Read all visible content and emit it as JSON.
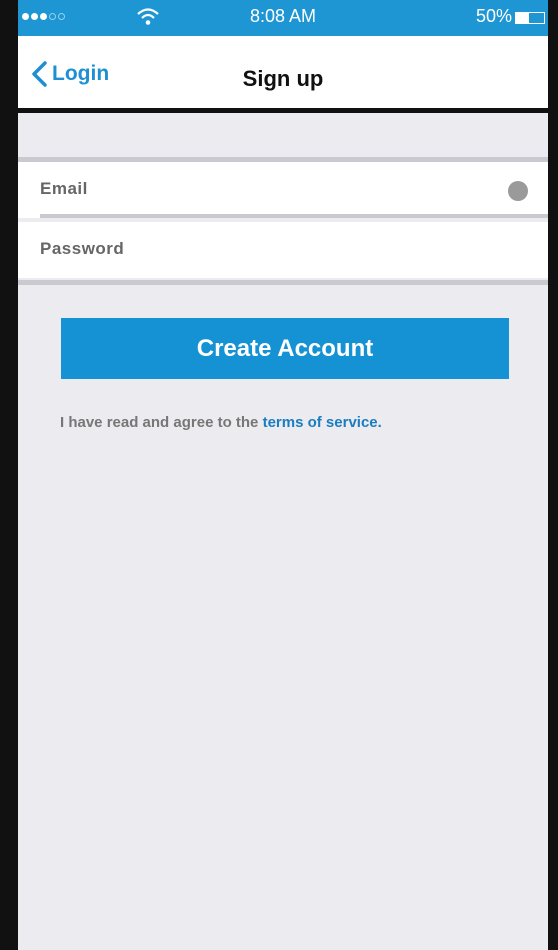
{
  "status_bar": {
    "time": "8:08 AM",
    "battery_percent": "50%",
    "battery_level": 0.45,
    "signal_bars_filled": 3,
    "signal_bars_total": 5,
    "wifi_icon": "wifi-icon"
  },
  "nav": {
    "back_label": "Login",
    "back_icon": "chevron-left-icon",
    "title": "Sign up"
  },
  "form": {
    "email_label": "Email",
    "password_label": "Password"
  },
  "actions": {
    "create_account_label": "Create Account"
  },
  "terms": {
    "prefix": "I have read and agree to the ",
    "link_label": "terms of service."
  },
  "colors": {
    "accent": "#1592d4",
    "status_bar": "#1e96d4",
    "link": "#1a7dc0",
    "background": "#ebebf0"
  }
}
